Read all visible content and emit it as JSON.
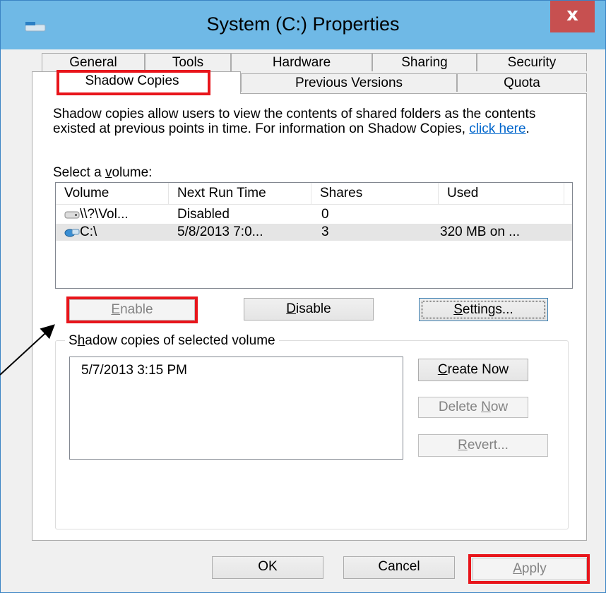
{
  "window": {
    "title": "System (C:) Properties",
    "close_glyph": "x",
    "title_bar_color": "#6fb9e6",
    "close_color": "#c75050",
    "highlight_color": "#e8151b"
  },
  "tabs_row1": [
    {
      "label": "General"
    },
    {
      "label": "Tools"
    },
    {
      "label": "Hardware"
    },
    {
      "label": "Sharing"
    },
    {
      "label": "Security"
    }
  ],
  "tabs_row2": [
    {
      "label": "Shadow Copies"
    },
    {
      "label": "Previous Versions"
    },
    {
      "label": "Quota"
    }
  ],
  "description": {
    "text": "Shadow copies allow users to view the contents of shared folders as the contents existed at previous points in time. For information on Shadow Copies, ",
    "link": "click here",
    "end": "."
  },
  "volume_section": {
    "label_pre": "Select a ",
    "label_key": "v",
    "label_post": "olume:",
    "columns": [
      "Volume",
      "Next Run Time",
      "Shares",
      "Used"
    ],
    "rows": [
      {
        "volume": "\\\\?\\Vol...",
        "next_run": "Disabled",
        "shares": "0",
        "used": "",
        "icon": "drive-icon"
      },
      {
        "volume": "C:\\",
        "next_run": "5/8/2013 7:0...",
        "shares": "3",
        "used": "320 MB on ...",
        "icon": "network-drive-icon"
      }
    ]
  },
  "buttons": {
    "enable_key": "E",
    "enable_rest": "nable",
    "disable_key": "D",
    "disable_rest": "isable",
    "settings_key": "S",
    "settings_rest": "ettings...",
    "create_key": "C",
    "create_rest": "reate Now",
    "delete_pre": "Delete ",
    "delete_key": "N",
    "delete_post": "ow",
    "revert_key": "R",
    "revert_rest": "evert...",
    "ok": "OK",
    "cancel": "Cancel",
    "apply_key": "A",
    "apply_rest": "pply"
  },
  "shadow_copies": {
    "legend_pre": "S",
    "legend_key": "h",
    "legend_post": "adow copies of selected volume",
    "items": [
      "5/7/2013 3:15 PM"
    ]
  }
}
